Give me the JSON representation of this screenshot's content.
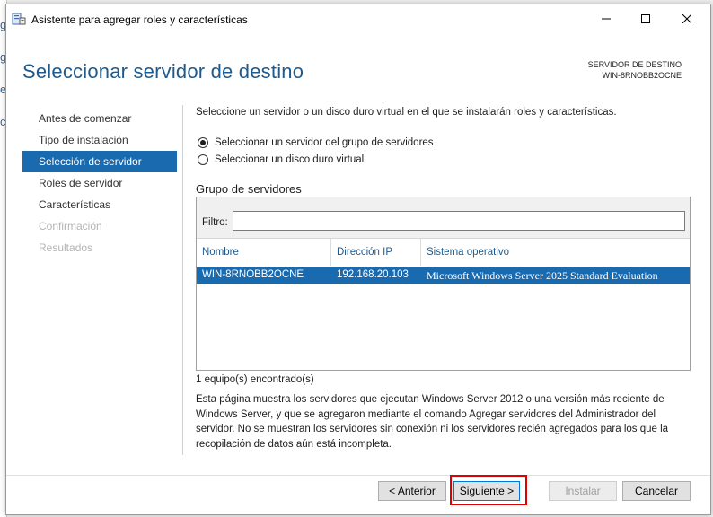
{
  "window": {
    "title": "Asistente para agregar roles y características",
    "minimize_glyph": "—",
    "maximize_glyph": "☐",
    "close_glyph": "✕"
  },
  "header": {
    "title": "Seleccionar servidor de destino",
    "destination_label": "SERVIDOR DE DESTINO",
    "destination_server": "WIN-8RNOBB2OCNE"
  },
  "nav": {
    "items": [
      {
        "label": "Antes de comenzar",
        "state": "normal"
      },
      {
        "label": "Tipo de instalación",
        "state": "normal"
      },
      {
        "label": "Selección de servidor",
        "state": "active"
      },
      {
        "label": "Roles de servidor",
        "state": "normal"
      },
      {
        "label": "Características",
        "state": "normal"
      },
      {
        "label": "Confirmación",
        "state": "disabled"
      },
      {
        "label": "Resultados",
        "state": "disabled"
      }
    ]
  },
  "content": {
    "intro": "Seleccione un servidor o un disco duro virtual en el que se instalarán roles y características.",
    "radio_pool": "Seleccionar un servidor del grupo de servidores",
    "radio_vhd": "Seleccionar un disco duro virtual",
    "pool_title": "Grupo de servidores",
    "filter_label": "Filtro:",
    "filter_value": "",
    "columns": [
      "Nombre",
      "Dirección IP",
      "Sistema operativo"
    ],
    "rows": [
      {
        "name": "WIN-8RNOBB2OCNE",
        "ip": "192.168.20.103",
        "os": "Microsoft Windows Server 2025 Standard Evaluation"
      }
    ],
    "count": "1 equipo(s) encontrado(s)",
    "description": "Esta página muestra los servidores que ejecutan Windows Server 2012 o una versión más reciente de Windows Server, y que se agregaron mediante el comando Agregar servidores del Administrador del servidor. No se muestran los servidores sin conexión ni los servidores recién agregados para los que la recopilación de datos aún está incompleta."
  },
  "buttons": {
    "previous": "< Anterior",
    "next": "Siguiente >",
    "install": "Instalar",
    "cancel": "Cancelar"
  },
  "colors": {
    "accent": "#1a6aaf",
    "title_blue": "#1f5a8c",
    "highlight_red": "#e00000"
  }
}
